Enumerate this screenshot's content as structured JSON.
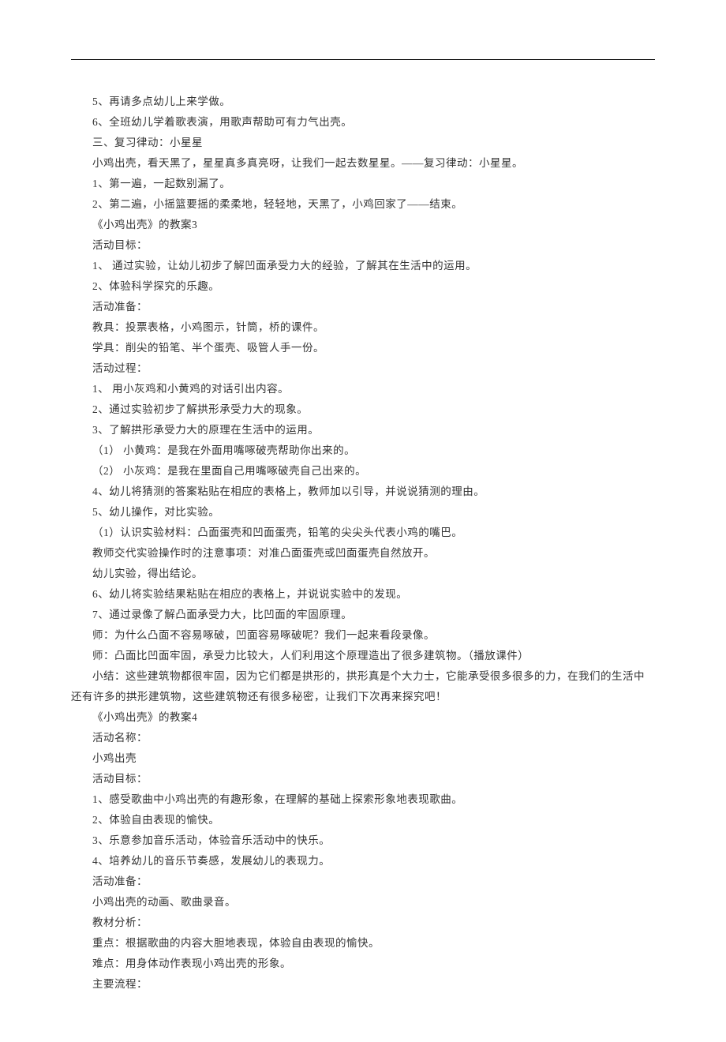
{
  "lines": [
    "5、再请多点幼儿上来学做。",
    "6、全班幼儿学着歌表演，用歌声帮助可有力气出壳。",
    "三、复习律动：小星星",
    "小鸡出壳，看天黑了，星星真多真亮呀，让我们一起去数星星。——复习律动：小星星。",
    "1、第一遍，一起数别漏了。",
    "2、第二遍，小摇篮要摇的柔柔地，轻轻地，天黑了，小鸡回家了——结束。",
    "《小鸡出壳》的教案3",
    "活动目标：",
    "1、 通过实验，让幼儿初步了解凹面承受力大的经验，了解其在生活中的运用。",
    "2、体验科学探究的乐趣。",
    "活动准备：",
    "教具：投票表格，小鸡图示，针筒，桥的课件。",
    "学具：削尖的铅笔、半个蛋壳、吸管人手一份。",
    "活动过程：",
    "1、 用小灰鸡和小黄鸡的对话引出内容。",
    "2、通过实验初步了解拱形承受力大的现象。",
    "3、了解拱形承受力大的原理在生活中的运用。",
    "（1） 小黄鸡：是我在外面用嘴啄破壳帮助你出来的。",
    "（2） 小灰鸡：是我在里面自己用嘴啄破壳自己出来的。",
    "4、幼儿将猜测的答案粘贴在相应的表格上，教师加以引导，并说说猜测的理由。",
    "5、幼儿操作，对比实验。",
    "（1）认识实验材料：凸面蛋壳和凹面蛋壳，铅笔的尖尖头代表小鸡的嘴巴。",
    "教师交代实验操作时的注意事项：对准凸面蛋壳或凹面蛋壳自然放开。",
    "幼儿实验，得出结论。",
    "6、幼儿将实验结果粘贴在相应的表格上，并说说实验中的发现。",
    "7、通过录像了解凸面承受力大，比凹面的牢固原理。",
    "师：为什么凸面不容易啄破，凹面容易啄破呢？我们一起来看段录像。",
    "师：凸面比凹面牢固，承受力比较大，人们利用这个原理造出了很多建筑物。（播放课件）",
    "小结：这些建筑物都很牢固，因为它们都是拱形的，拱形真是个大力士，它能承受很多很多的力，在我们的生活中还有许多的拱形建筑物，这些建筑物还有很多秘密，让我们下次再来探究吧！",
    "《小鸡出壳》的教案4",
    "活动名称：",
    "小鸡出壳",
    "活动目标：",
    "1、感受歌曲中小鸡出壳的有趣形象，在理解的基础上探索形象地表现歌曲。",
    "2、体验自由表现的愉快。",
    "3、乐意参加音乐活动，体验音乐活动中的快乐。",
    "4、培养幼儿的音乐节奏感，发展幼儿的表现力。",
    "活动准备：",
    "小鸡出壳的动画、歌曲录音。",
    "教材分析：",
    "重点：根据歌曲的内容大胆地表现，体验自由表现的愉快。",
    "难点：用身体动作表现小鸡出壳的形象。",
    "主要流程："
  ]
}
